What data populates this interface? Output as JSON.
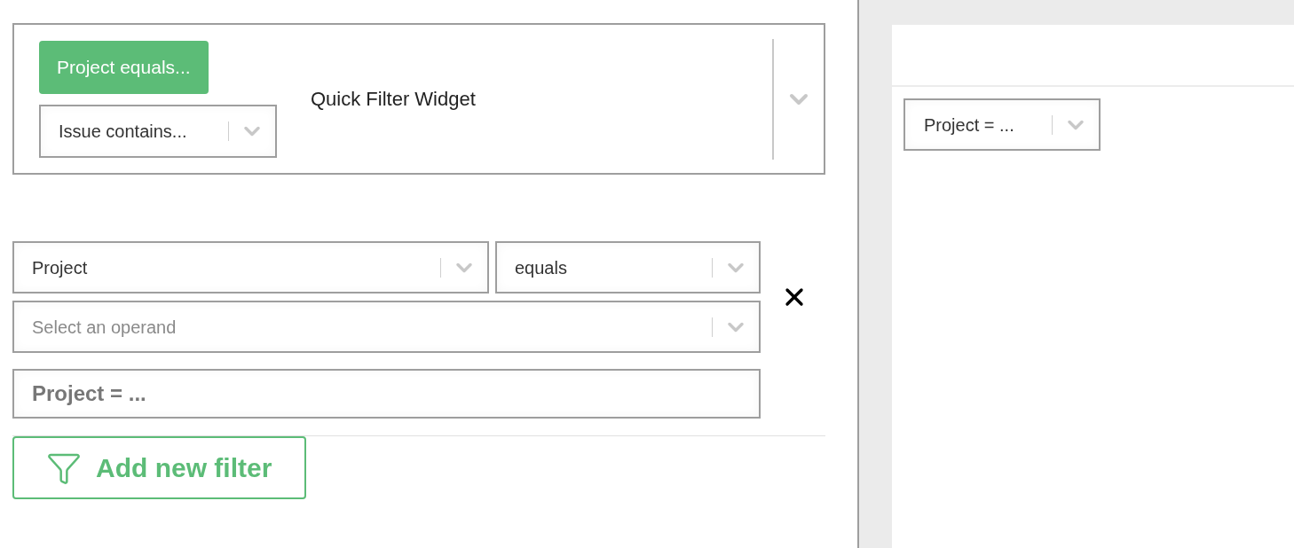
{
  "widget": {
    "items": [
      {
        "kind": "button",
        "label": "Project equals..."
      },
      {
        "kind": "dropdown",
        "label": "Issue contains..."
      }
    ],
    "title": "Quick Filter Widget"
  },
  "filter": {
    "field": "Project",
    "operator": "equals",
    "operand": {
      "placeholder": "Select an operand"
    },
    "label_value": "Project = ..."
  },
  "add_button": "Add new filter",
  "preview": {
    "dropdown": "Project = ..."
  }
}
